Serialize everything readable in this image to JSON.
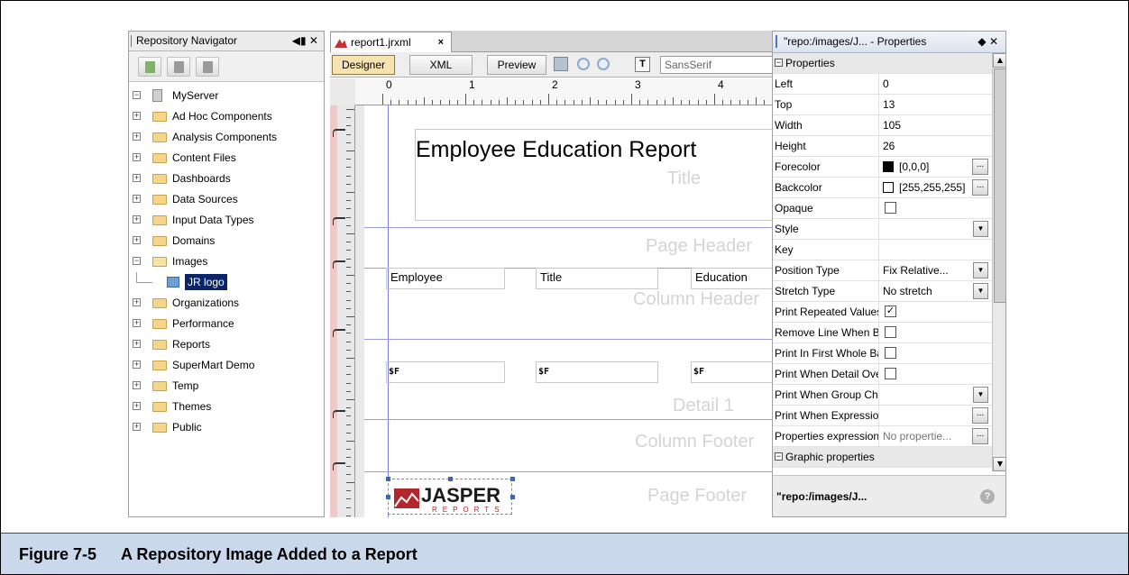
{
  "caption": {
    "number": "Figure 7-5",
    "text": "A Repository Image Added to a Report"
  },
  "repository": {
    "title": "Repository Navigator",
    "controls": "◀▮ ✕",
    "tree": {
      "root": "MyServer",
      "items": [
        "Ad Hoc Components",
        "Analysis Components",
        "Content Files",
        "Dashboards",
        "Data Sources",
        "Input Data Types",
        "Domains",
        "Images",
        "Organizations",
        "Performance",
        "Reports",
        "SuperMart Demo",
        "Temp",
        "Themes",
        "Public"
      ],
      "child_of_images": "JR logo"
    }
  },
  "designer": {
    "file_tab": "report1.jrxml",
    "close_mark": "×",
    "modes": [
      "Designer",
      "XML",
      "Preview"
    ],
    "font_value": "SansSerif",
    "ruler_numbers": [
      "0",
      "1",
      "2",
      "3",
      "4"
    ],
    "report_title": "Employee Education Report",
    "bands": [
      "Title",
      "Page Header",
      "Column Header",
      "Detail 1",
      "Column Footer",
      "Page Footer"
    ],
    "columns": [
      "Employee",
      "Title",
      "Education"
    ],
    "fields": [
      "$F",
      "$F",
      "$F"
    ],
    "logo": {
      "word": "JASPER",
      "sub": "REPORTS"
    }
  },
  "properties": {
    "title": "\"repo:/images/J... - Properties",
    "controls": "◆ ✕",
    "category_properties": "Properties",
    "category_graphic": "Graphic properties",
    "rows": [
      {
        "name": "Left",
        "value": "0"
      },
      {
        "name": "Top",
        "value": "13"
      },
      {
        "name": "Width",
        "value": "105"
      },
      {
        "name": "Height",
        "value": "26"
      },
      {
        "name": "Forecolor",
        "value": "[0,0,0]"
      },
      {
        "name": "Backcolor",
        "value": "[255,255,255]"
      },
      {
        "name": "Opaque",
        "value": ""
      },
      {
        "name": "Style",
        "value": ""
      },
      {
        "name": "Key",
        "value": ""
      },
      {
        "name": "Position Type",
        "value": "Fix Relative..."
      },
      {
        "name": "Stretch Type",
        "value": "No stretch"
      },
      {
        "name": "Print Repeated Values",
        "value": ""
      },
      {
        "name": "Remove Line When Blank",
        "value": ""
      },
      {
        "name": "Print In First Whole Band",
        "value": ""
      },
      {
        "name": "Print When Detail Overflows",
        "value": ""
      },
      {
        "name": "Print When Group Changes",
        "value": ""
      },
      {
        "name": "Print When Expression",
        "value": ""
      },
      {
        "name": "Properties expressions",
        "value": "No propertie..."
      }
    ],
    "footer": "\"repo:/images/J...",
    "colors": {
      "forecolor": "#000000",
      "backcolor": "#ffffff"
    }
  }
}
